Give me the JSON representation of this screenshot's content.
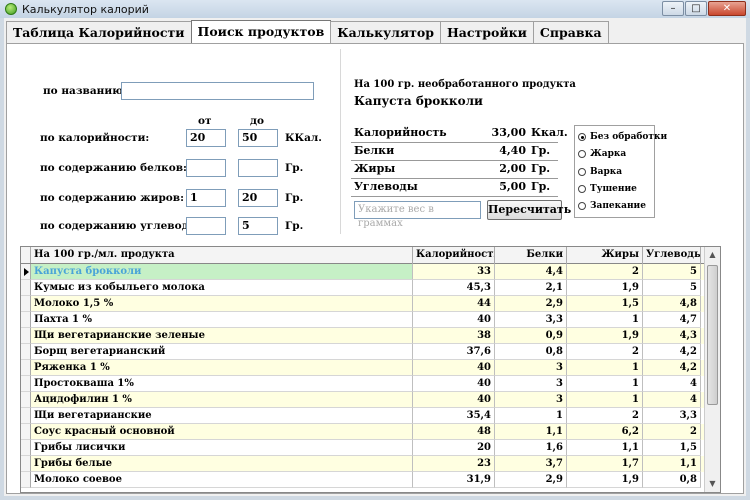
{
  "window": {
    "title": "Калькулятор калорий",
    "minimize": "–",
    "maximize": "□",
    "close": "✕"
  },
  "tabs": [
    {
      "label": "Таблица Калорийности"
    },
    {
      "label": "Поиск продуктов"
    },
    {
      "label": "Калькулятор"
    },
    {
      "label": "Настройки"
    },
    {
      "label": "Справка"
    }
  ],
  "search": {
    "by_name_label": "по названию:",
    "name_value": "",
    "from_label": "от",
    "to_label": "до",
    "calorie_label": "по калорийности:",
    "calorie_from": "20",
    "calorie_to": "50",
    "calorie_unit": "ККал.",
    "protein_label": "по содержанию белков:",
    "protein_from": "",
    "protein_to": "",
    "protein_unit": "Гр.",
    "fat_label": "по содержанию жиров:",
    "fat_from": "1",
    "fat_to": "20",
    "fat_unit": "Гр.",
    "carbs_label": "по содержанию углеводов:",
    "carbs_from": "",
    "carbs_to": "5",
    "carbs_unit": "Гр."
  },
  "info": {
    "header": "На 100 гр. необработанного продукта",
    "product": "Капуста брокколи",
    "calories_label": "Калорийность",
    "calories_value": "33,00",
    "calories_unit": "Ккал.",
    "protein_label": "Белки",
    "protein_value": "4,40",
    "protein_unit": "Гр.",
    "fat_label": "Жиры",
    "fat_value": "2,00",
    "fat_unit": "Гр.",
    "carbs_label": "Углеводы",
    "carbs_value": "5,00",
    "carbs_unit": "Гр.",
    "weight_placeholder": "Укажите вес в граммах",
    "recalc_button": "Пересчитать"
  },
  "cooking": [
    {
      "label": "Без обработки",
      "selected": true
    },
    {
      "label": "Жарка",
      "selected": false
    },
    {
      "label": "Варка",
      "selected": false
    },
    {
      "label": "Тушение",
      "selected": false
    },
    {
      "label": "Запекание",
      "selected": false
    }
  ],
  "table": {
    "columns": [
      "На 100 гр./мл. продукта",
      "Калорийность",
      "Белки",
      "Жиры",
      "Углеводы"
    ],
    "rows": [
      [
        "Капуста брокколи",
        "33",
        "4,4",
        "2",
        "5"
      ],
      [
        "Кумыс из кобыльего молока",
        "45,3",
        "2,1",
        "1,9",
        "5"
      ],
      [
        "Молоко 1,5 %",
        "44",
        "2,9",
        "1,5",
        "4,8"
      ],
      [
        "Пахта 1 %",
        "40",
        "3,3",
        "1",
        "4,7"
      ],
      [
        "Щи вегетарианские зеленые",
        "38",
        "0,9",
        "1,9",
        "4,3"
      ],
      [
        "Борщ вегетарианский",
        "37,6",
        "0,8",
        "2",
        "4,2"
      ],
      [
        "Ряженка 1 %",
        "40",
        "3",
        "1",
        "4,2"
      ],
      [
        "Простокваша 1%",
        "40",
        "3",
        "1",
        "4"
      ],
      [
        "Ацидофилин 1 %",
        "40",
        "3",
        "1",
        "4"
      ],
      [
        "Щи вегетарианские",
        "35,4",
        "1",
        "2",
        "3,3"
      ],
      [
        "Соус красный основной",
        "48",
        "1,1",
        "6,2",
        "2"
      ],
      [
        "Грибы лисички",
        "20",
        "1,6",
        "1,1",
        "1,5"
      ],
      [
        "Грибы белые",
        "23",
        "3,7",
        "1,7",
        "1,1"
      ],
      [
        "Молоко соевое",
        "31,9",
        "2,9",
        "1,9",
        "0,8"
      ]
    ],
    "selected_row": 0
  },
  "scroll": {
    "up": "▲",
    "down": "▼"
  }
}
